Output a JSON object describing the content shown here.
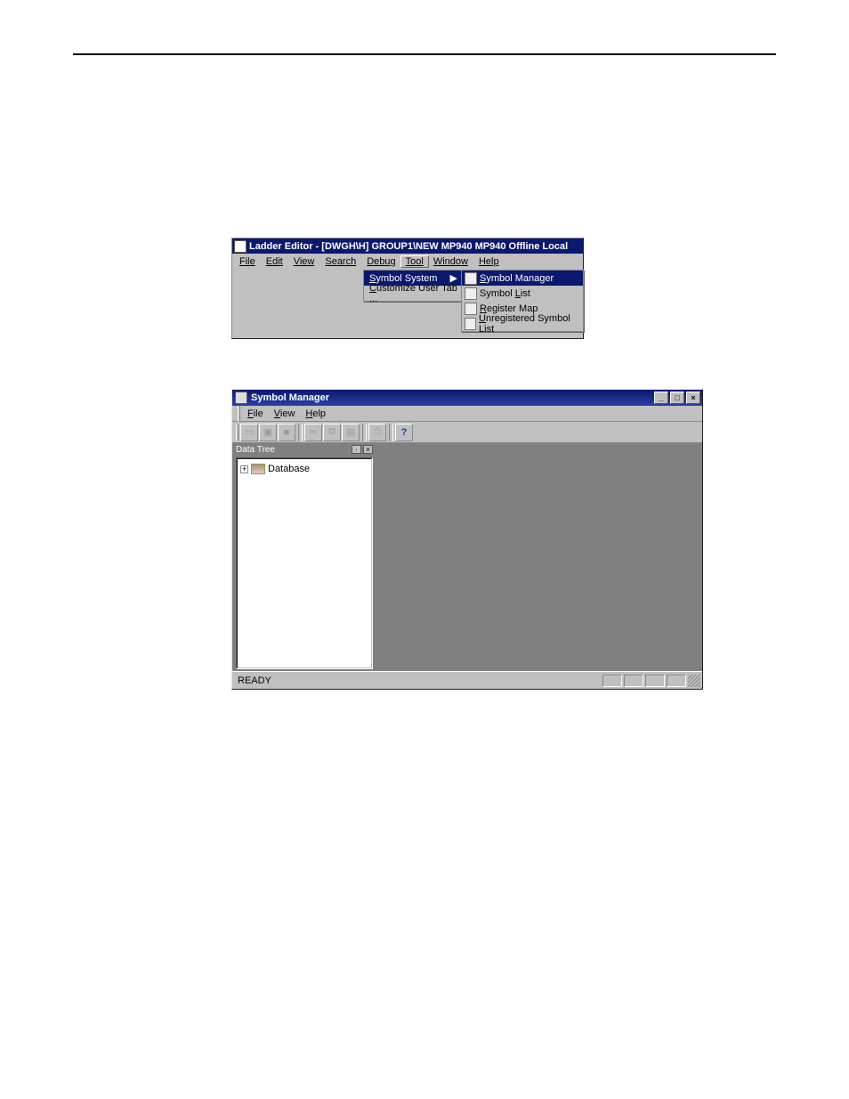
{
  "ladder": {
    "title": "Ladder Editor - [DWGH\\H]     GROUP1\\NEW  MP940  MP940        Offline  Local",
    "menus": [
      "File",
      "Edit",
      "View",
      "Search",
      "Debug",
      "Tool",
      "Window",
      "Help"
    ],
    "tool_menu": {
      "items": [
        {
          "label": "Symbol System",
          "has_sub": true
        },
        {
          "label": "Customize User Tab ...",
          "has_sub": false
        }
      ],
      "selected": 0
    },
    "submenu": {
      "items": [
        {
          "label": "Symbol Manager"
        },
        {
          "label": "Symbol List"
        },
        {
          "label": "Register Map"
        },
        {
          "label": "Unregistered Symbol List"
        }
      ],
      "selected": 0
    }
  },
  "sm": {
    "title": "Symbol Manager",
    "menus": [
      "File",
      "View",
      "Help"
    ],
    "tree_title": "Data Tree",
    "tree_root": "Database",
    "status": "READY"
  },
  "icons": {
    "arrow_r": "▶",
    "expand": "+",
    "minimize": "_",
    "maximize": "□",
    "close": "×",
    "help": "?",
    "new_doc": "▭",
    "folder": "▣",
    "save": "■",
    "cut": "✂",
    "copy": "⧉",
    "paste": "▤",
    "print": "⎙",
    "dot": "·"
  }
}
